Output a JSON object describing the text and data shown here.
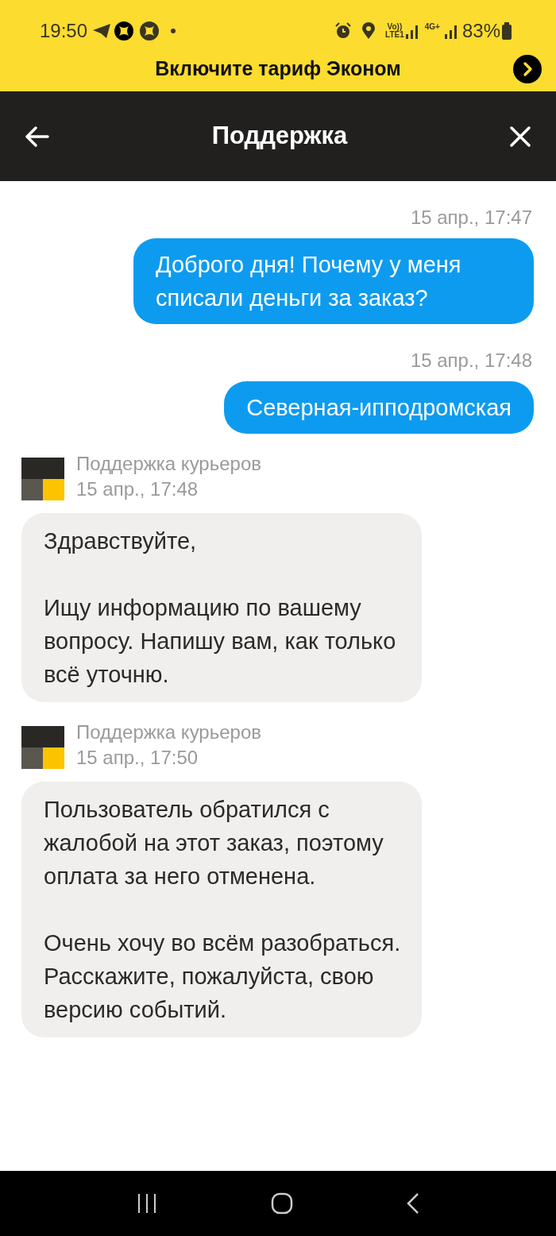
{
  "status_bar": {
    "time": "19:50",
    "volte": "Vo))",
    "lte": "LTE1",
    "network": "4G+",
    "battery": "83%"
  },
  "banner": {
    "text": "Включите тариф Эконом"
  },
  "header": {
    "title": "Поддержка"
  },
  "messages": [
    {
      "kind": "outgoing",
      "time": "15 апр., 17:47",
      "paragraphs": [
        "Доброго дня! Почему у меня списали деньги за заказ?"
      ]
    },
    {
      "kind": "outgoing",
      "time": "15 апр., 17:48",
      "paragraphs": [
        "Северная-ипподромская"
      ]
    },
    {
      "kind": "incoming",
      "sender": "Поддержка курьеров",
      "time": "15 апр., 17:48",
      "paragraphs": [
        "Здравствуйте,",
        "Ищу информацию по вашему вопросу. Напишу вам, как только всё уточню."
      ]
    },
    {
      "kind": "incoming",
      "sender": "Поддержка курьеров",
      "time": "15 апр., 17:50",
      "paragraphs": [
        "Пользователь обратился с жалобой на этот заказ, поэтому оплата за него отменена.",
        "Очень хочу во всём разобраться. Расскажите, пожалуйста, свою версию событий."
      ]
    }
  ]
}
